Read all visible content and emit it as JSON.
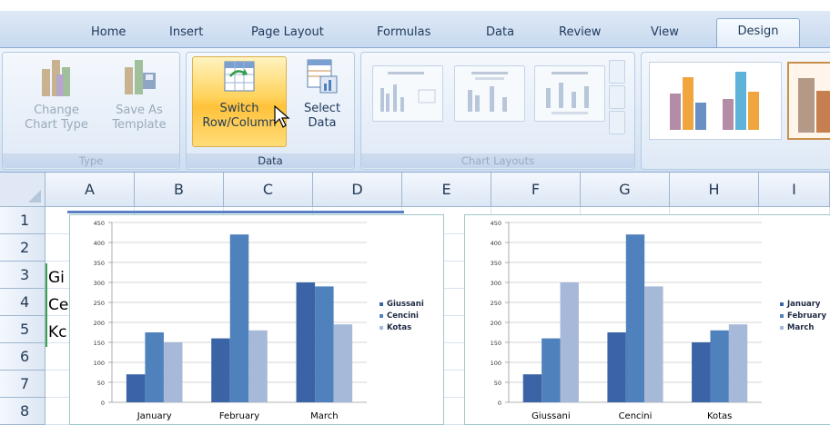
{
  "tabs": [
    {
      "label": "Home"
    },
    {
      "label": "Insert"
    },
    {
      "label": "Page Layout"
    },
    {
      "label": "Formulas"
    },
    {
      "label": "Data"
    },
    {
      "label": "Review"
    },
    {
      "label": "View"
    },
    {
      "label": "Design"
    }
  ],
  "ribbon": {
    "type_group": {
      "label": "Type",
      "change_chart_type": {
        "line1": "Change",
        "line2": "Chart Type"
      },
      "save_as_template": {
        "line1": "Save As",
        "line2": "Template"
      }
    },
    "data_group": {
      "label": "Data",
      "switch_row_column": {
        "line1": "Switch",
        "line2": "Row/Column"
      },
      "select_data": {
        "line1": "Select",
        "line2": "Data"
      }
    },
    "chart_layouts_group": {
      "label": "Chart Layouts"
    }
  },
  "columns": [
    "A",
    "B",
    "C",
    "D",
    "E",
    "F",
    "G",
    "H",
    "I"
  ],
  "rows": [
    "1",
    "2",
    "3",
    "4",
    "5",
    "6",
    "7",
    "8"
  ],
  "cells": {
    "a3": "Gi",
    "a4": "Ce",
    "a5": "Kc"
  },
  "colors": {
    "series1": "#3a64a6",
    "series2": "#4f81bd",
    "series3": "#a6b9d8",
    "ribbon_accent": "#ffc23a"
  },
  "chart_data": [
    {
      "type": "bar",
      "categories": [
        "January",
        "February",
        "March"
      ],
      "series": [
        {
          "name": "Giussani",
          "values": [
            70,
            160,
            300
          ]
        },
        {
          "name": "Cencini",
          "values": [
            175,
            420,
            290
          ]
        },
        {
          "name": "Kotas",
          "values": [
            150,
            180,
            195
          ]
        }
      ],
      "ylim": [
        0,
        450
      ],
      "yticks": [
        "0",
        "50",
        "100",
        "150",
        "200",
        "250",
        "300",
        "350",
        "400",
        "450"
      ],
      "grid": true,
      "legend": "right"
    },
    {
      "type": "bar",
      "categories": [
        "Giussani",
        "Cencini",
        "Kotas"
      ],
      "series": [
        {
          "name": "January",
          "values": [
            70,
            175,
            150
          ]
        },
        {
          "name": "February",
          "values": [
            160,
            420,
            180
          ]
        },
        {
          "name": "March",
          "values": [
            300,
            290,
            195
          ]
        }
      ],
      "ylim": [
        0,
        450
      ],
      "yticks": [
        "0",
        "50",
        "100",
        "150",
        "200",
        "250",
        "300",
        "350",
        "400",
        "450"
      ],
      "grid": true,
      "legend": "right"
    }
  ]
}
